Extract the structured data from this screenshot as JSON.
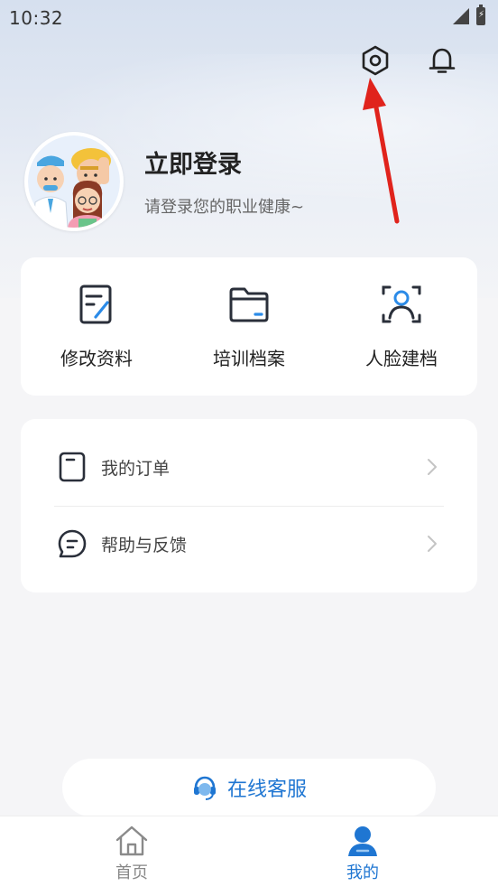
{
  "status_bar": {
    "time": "10:32",
    "battery_glyph": "⚡"
  },
  "header": {
    "settings_icon": "hexagon-gear-icon",
    "notification_icon": "bell-icon"
  },
  "profile": {
    "title": "立即登录",
    "subtitle": "请登录您的职业健康~"
  },
  "quick_actions": [
    {
      "label": "修改资料",
      "icon": "edit-document-icon"
    },
    {
      "label": "培训档案",
      "icon": "folder-icon"
    },
    {
      "label": "人脸建档",
      "icon": "face-scan-icon"
    }
  ],
  "menu_list": [
    {
      "label": "我的订单",
      "icon": "order-icon"
    },
    {
      "label": "帮助与反馈",
      "icon": "chat-feedback-icon"
    }
  ],
  "service": {
    "label": "在线客服",
    "icon": "headset-icon"
  },
  "tabbar": {
    "tabs": [
      {
        "label": "首页",
        "icon": "home-icon",
        "active": false
      },
      {
        "label": "我的",
        "icon": "person-icon",
        "active": true
      }
    ]
  },
  "colors": {
    "accent": "#1f76d2",
    "annotation_arrow": "#e0231c",
    "inactive_tab": "#888888"
  }
}
